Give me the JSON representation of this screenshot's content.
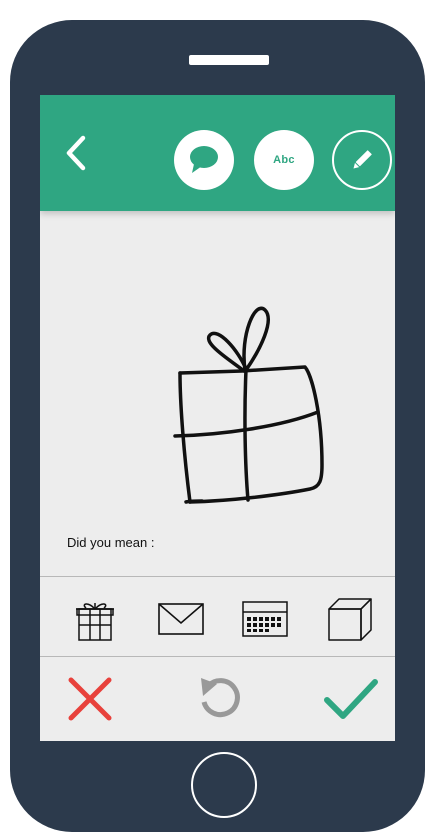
{
  "prompt": {
    "label": "Did you mean :"
  },
  "toolbar": {
    "abc_label": "Abc"
  },
  "colors": {
    "header": "#2fa682",
    "phone_body": "#2c3a4c",
    "screen": "#ededed",
    "cancel": "#e8413c",
    "confirm": "#2fa682",
    "undo": "#999999"
  },
  "icons": {
    "back": "chevron-left-icon",
    "speech": "speech-bubble-icon",
    "pen": "pencil-icon",
    "suggestions": [
      "gift-icon",
      "envelope-icon",
      "calendar-icon",
      "cube-icon"
    ],
    "cancel": "cross-icon",
    "undo": "undo-icon",
    "confirm": "checkmark-icon"
  }
}
